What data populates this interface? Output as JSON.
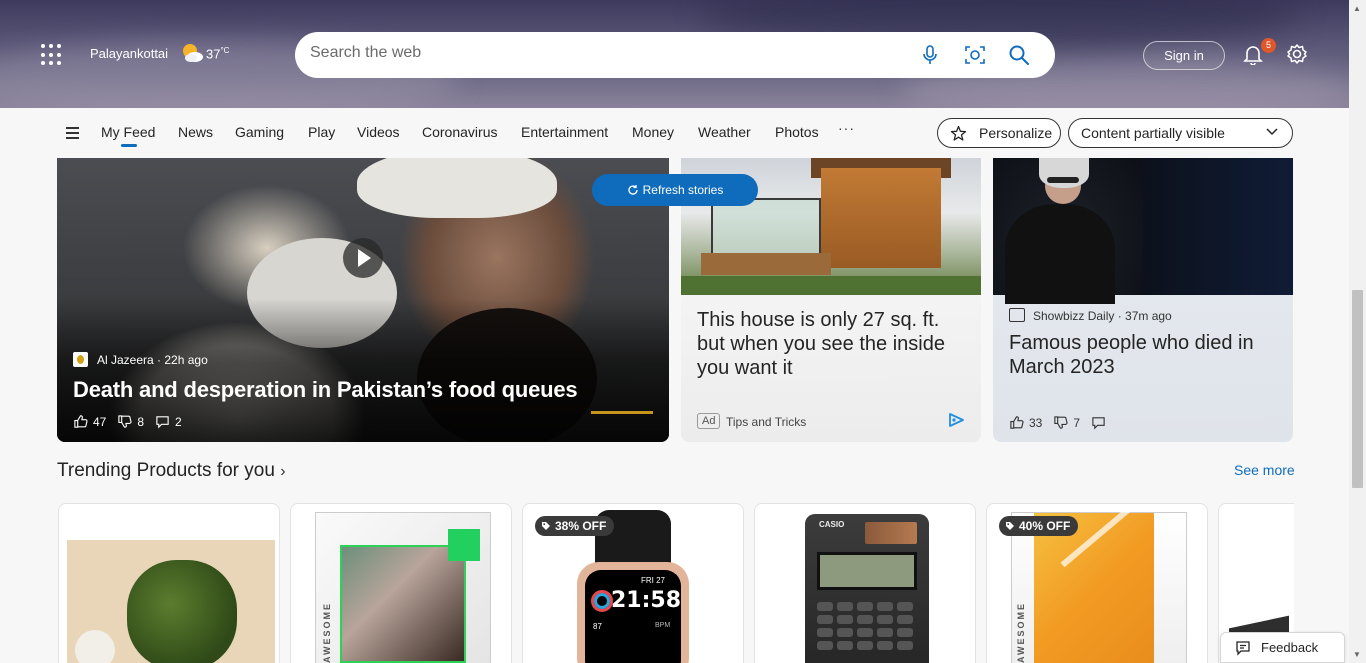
{
  "header": {
    "location": "Palayankottai",
    "temperature": "37",
    "temp_unit": "°C",
    "search_placeholder": "Search the web",
    "sign_in": "Sign in",
    "notification_count": "5"
  },
  "nav": {
    "items": [
      "My Feed",
      "News",
      "Gaming",
      "Play",
      "Videos",
      "Coronavirus",
      "Entertainment",
      "Money",
      "Weather",
      "Photos"
    ],
    "more": "···",
    "personalize": "Personalize",
    "content_visibility": "Content partially visible"
  },
  "refresh_label": "Refresh stories",
  "cards": {
    "main": {
      "source": "Al Jazeera · 22h ago",
      "title": "Death and desperation in Pakistan’s food queues",
      "likes": "47",
      "dislikes": "8",
      "comments": "2"
    },
    "ad": {
      "title": "This house is only 27 sq. ft. but when you see the inside you want it",
      "ad_tag": "Ad",
      "source": "Tips and Tricks"
    },
    "showbizz": {
      "source": "Showbizz Daily · 37m ago",
      "title": "Famous people who died in March 2023",
      "likes": "33",
      "dislikes": "7"
    }
  },
  "trending": {
    "title": "Trending Products for you",
    "see_more": "See more",
    "products": [
      {
        "discount": ""
      },
      {
        "discount": ""
      },
      {
        "discount": "38% OFF",
        "watch_time": "21:58",
        "watch_day": "FRI   27",
        "watch_bpm": "BPM",
        "watch_hr": "87"
      },
      {
        "discount": "",
        "brand": "CASIO"
      },
      {
        "discount": "40% OFF"
      },
      {
        "discount": ""
      }
    ]
  },
  "feedback": "Feedback",
  "colors": {
    "accent": "#0f6cbd",
    "badge": "#e0572a"
  }
}
